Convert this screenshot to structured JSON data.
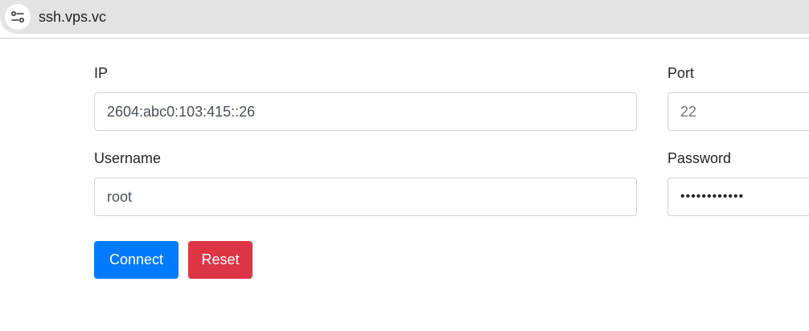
{
  "browser": {
    "url": "ssh.vps.vc",
    "site_icon": "tune-icon"
  },
  "form": {
    "ip": {
      "label": "IP",
      "value": "2604:abc0:103:415::26"
    },
    "port": {
      "label": "Port",
      "placeholder": "22"
    },
    "username": {
      "label": "Username",
      "value": "root"
    },
    "password": {
      "label": "Password",
      "value": "••••••••••••"
    }
  },
  "buttons": {
    "connect": "Connect",
    "reset": "Reset"
  },
  "colors": {
    "primary": "#007bff",
    "danger": "#dc3545"
  }
}
